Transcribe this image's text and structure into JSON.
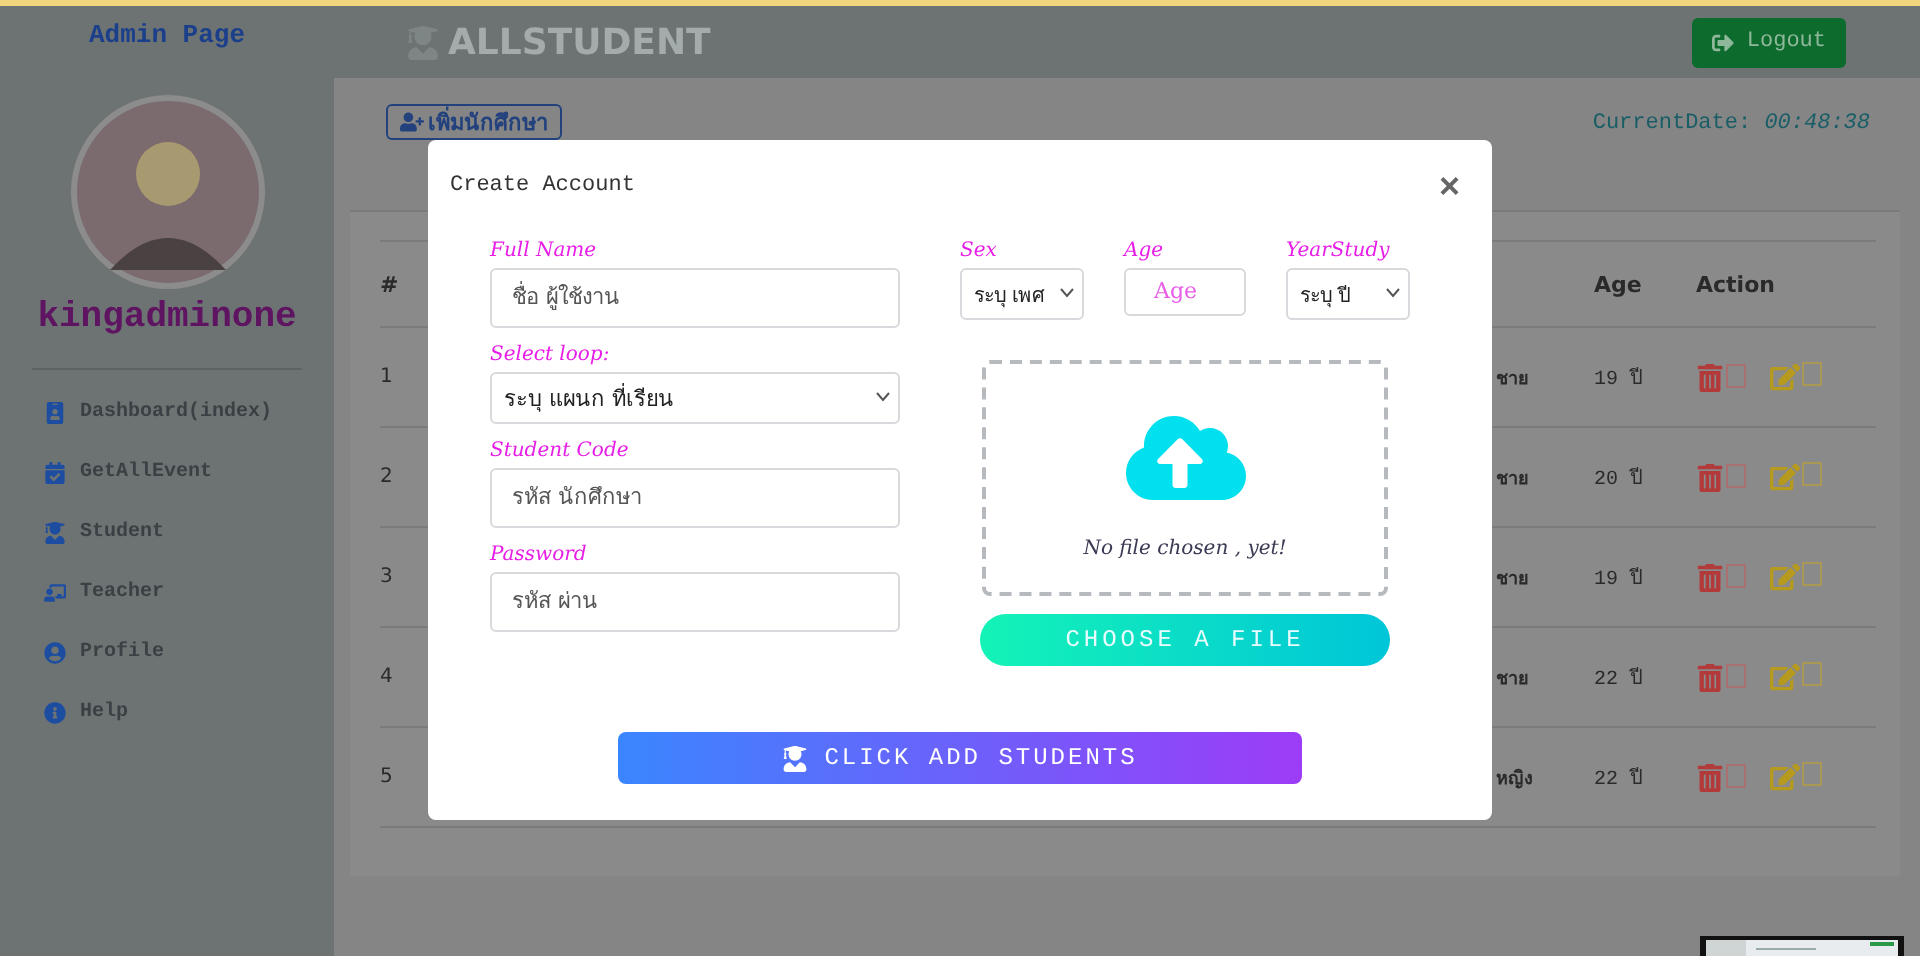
{
  "sidebar": {
    "title": "Admin Page",
    "username": "kingadminone",
    "items": [
      {
        "kind": "dashboard",
        "label": "Dashboard(index)"
      },
      {
        "kind": "event",
        "label": "GetAllEvent"
      },
      {
        "kind": "student",
        "label": "Student"
      },
      {
        "kind": "teacher",
        "label": "Teacher"
      },
      {
        "kind": "profile",
        "label": "Profile"
      },
      {
        "kind": "help",
        "label": "Help"
      }
    ]
  },
  "topbar": {
    "brand": "ALLSTUDENT",
    "logout": "Logout"
  },
  "toolbar": {
    "add_button": "เพิ่มนักศึกษา",
    "date_label": "CurrentDate:",
    "time": "00:48:38"
  },
  "table": {
    "columns": [
      {
        "label": "#"
      },
      {
        "label": "Age"
      },
      {
        "label": "Action"
      }
    ],
    "rows": [
      {
        "number": "1",
        "column_2": "ชาย",
        "age": "19 ปี"
      },
      {
        "number": "2",
        "column_2": "ชาย",
        "age": "20 ปี"
      },
      {
        "number": "3",
        "column_2": "ชาย",
        "age": "19 ปี"
      },
      {
        "number": "4",
        "column_2": "ชาย",
        "age": "22 ปี"
      },
      {
        "number": "5",
        "column_2": "หญิง",
        "age": "22 ปี"
      }
    ]
  },
  "modal": {
    "title": "Create Account",
    "close": "×",
    "left_fields": [
      {
        "kind": "input",
        "label": "Full Name",
        "placeholder": "ชื่อ ผู้ใช้งาน"
      },
      {
        "kind": "select",
        "label": "Select loop:",
        "value": "ระบุ แผนก ที่เรียน"
      },
      {
        "kind": "input",
        "label": "Student Code",
        "placeholder": "รหัส นักศึกษา"
      },
      {
        "kind": "input",
        "label": "Password",
        "placeholder": "รหัส ผ่าน"
      }
    ],
    "right_fields": [
      {
        "kind": "select",
        "label": "Sex",
        "value": "ระบุ เพศ"
      },
      {
        "kind": "input",
        "label": "Age",
        "placeholder": "Age"
      },
      {
        "kind": "select",
        "label": "YearStudy",
        "value": "ระบุ ปี"
      }
    ],
    "upload": {
      "status": "No file chosen , yet!",
      "button": "CHOOSE A FILE"
    },
    "submit": "CLICK ADD STUDENTS"
  }
}
